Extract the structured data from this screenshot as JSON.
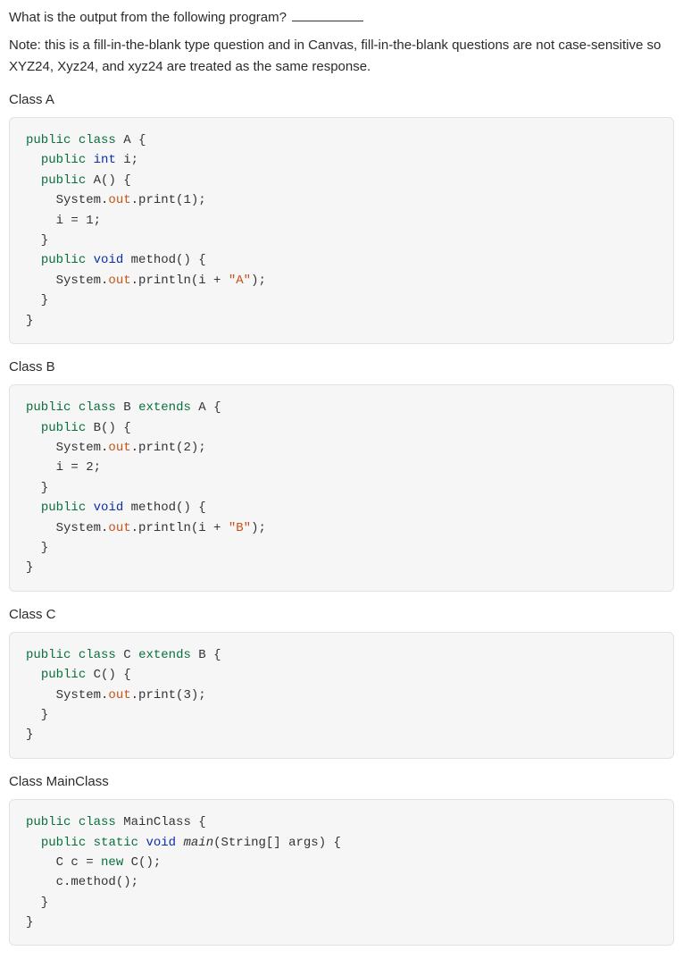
{
  "question": {
    "prompt": "What is the output from the following program?",
    "blank_label": ""
  },
  "note": "Note: this is a fill-in-the-blank type question and in Canvas, fill-in-the-blank questions are not case-sensitive so XYZ24, Xyz24, and xyz24 are treated as the same response.",
  "blocks": [
    {
      "label": "Class A",
      "lines": [
        [
          {
            "t": "public",
            "c": "kw"
          },
          " ",
          {
            "t": "class",
            "c": "kw"
          },
          " A {"
        ],
        [
          "  ",
          {
            "t": "public",
            "c": "kw"
          },
          " ",
          {
            "t": "int",
            "c": "typ"
          },
          " i;"
        ],
        [
          "  ",
          {
            "t": "public",
            "c": "kw"
          },
          " A() {"
        ],
        [
          "    System.",
          {
            "t": "out",
            "c": "fld"
          },
          ".print(",
          {
            "t": "1",
            "c": "id"
          },
          ");"
        ],
        [
          "    i = ",
          {
            "t": "1",
            "c": "id"
          },
          ";"
        ],
        [
          "  }"
        ],
        [
          "  ",
          {
            "t": "public",
            "c": "kw"
          },
          " ",
          {
            "t": "void",
            "c": "typ"
          },
          " method() {"
        ],
        [
          "    System.",
          {
            "t": "out",
            "c": "fld"
          },
          ".println(i + ",
          {
            "t": "\"A\"",
            "c": "str"
          },
          ");"
        ],
        [
          "  }"
        ],
        [
          "}"
        ]
      ]
    },
    {
      "label": "Class B",
      "lines": [
        [
          {
            "t": "public",
            "c": "kw"
          },
          " ",
          {
            "t": "class",
            "c": "kw"
          },
          " B ",
          {
            "t": "extends",
            "c": "kw"
          },
          " A {"
        ],
        [
          "  ",
          {
            "t": "public",
            "c": "kw"
          },
          " B() {"
        ],
        [
          "    System.",
          {
            "t": "out",
            "c": "fld"
          },
          ".print(",
          {
            "t": "2",
            "c": "id"
          },
          ");"
        ],
        [
          "    i = ",
          {
            "t": "2",
            "c": "id"
          },
          ";"
        ],
        [
          "  }"
        ],
        [
          "  ",
          {
            "t": "public",
            "c": "kw"
          },
          " ",
          {
            "t": "void",
            "c": "typ"
          },
          " method() {"
        ],
        [
          "    System.",
          {
            "t": "out",
            "c": "fld"
          },
          ".println(i + ",
          {
            "t": "\"B\"",
            "c": "str"
          },
          ");"
        ],
        [
          "  }"
        ],
        [
          "}"
        ]
      ]
    },
    {
      "label": "Class C",
      "lines": [
        [
          {
            "t": "public",
            "c": "kw"
          },
          " ",
          {
            "t": "class",
            "c": "kw"
          },
          " C ",
          {
            "t": "extends",
            "c": "kw"
          },
          " B {"
        ],
        [
          "  ",
          {
            "t": "public",
            "c": "kw"
          },
          " C() {"
        ],
        [
          "    System.",
          {
            "t": "out",
            "c": "fld"
          },
          ".print(",
          {
            "t": "3",
            "c": "id"
          },
          ");"
        ],
        [
          "  }"
        ],
        [
          "}"
        ]
      ]
    },
    {
      "label": "Class MainClass",
      "lines": [
        [
          {
            "t": "public",
            "c": "kw"
          },
          " ",
          {
            "t": "class",
            "c": "kw"
          },
          " MainClass {"
        ],
        [
          "  ",
          {
            "t": "public",
            "c": "kw"
          },
          " ",
          {
            "t": "static",
            "c": "kw"
          },
          " ",
          {
            "t": "void",
            "c": "typ"
          },
          " ",
          {
            "t": "main",
            "c": "id",
            "i": true
          },
          "(String[] args) {"
        ],
        [
          "    C c = ",
          {
            "t": "new",
            "c": "kw"
          },
          " C();"
        ],
        [
          "    c.method();"
        ],
        [
          "  }"
        ],
        [
          "}"
        ]
      ]
    }
  ]
}
